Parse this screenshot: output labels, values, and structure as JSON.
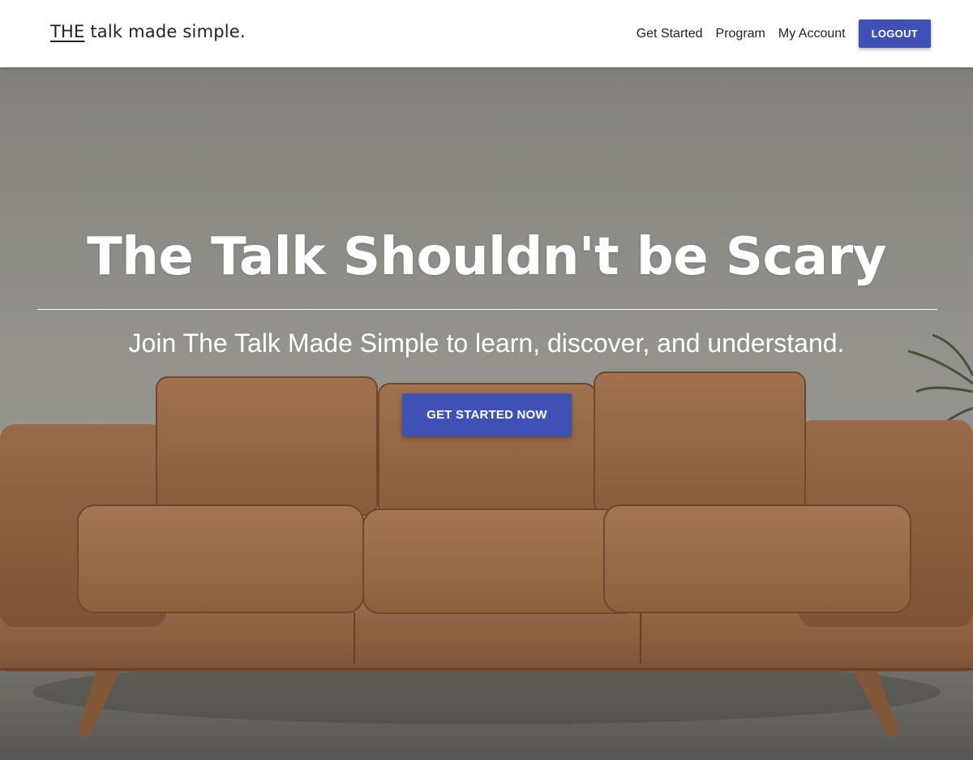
{
  "header": {
    "logo_prefix": "THE",
    "logo_rest": " talk made simple.",
    "nav": [
      {
        "label": "Get Started"
      },
      {
        "label": "Program"
      },
      {
        "label": "My Account"
      }
    ],
    "logout_label": "LOGOUT"
  },
  "hero": {
    "title": "The Talk Shouldn't be Scary",
    "subtitle": "Join The Talk Made Simple to learn, discover, and understand.",
    "cta_label": "GET STARTED NOW",
    "background_image": "brown-leather-sofa"
  },
  "colors": {
    "primary": "#3f51b5",
    "navbar_bg": "#ffffff",
    "text_dark": "#222222",
    "hero_text": "#ffffff"
  }
}
